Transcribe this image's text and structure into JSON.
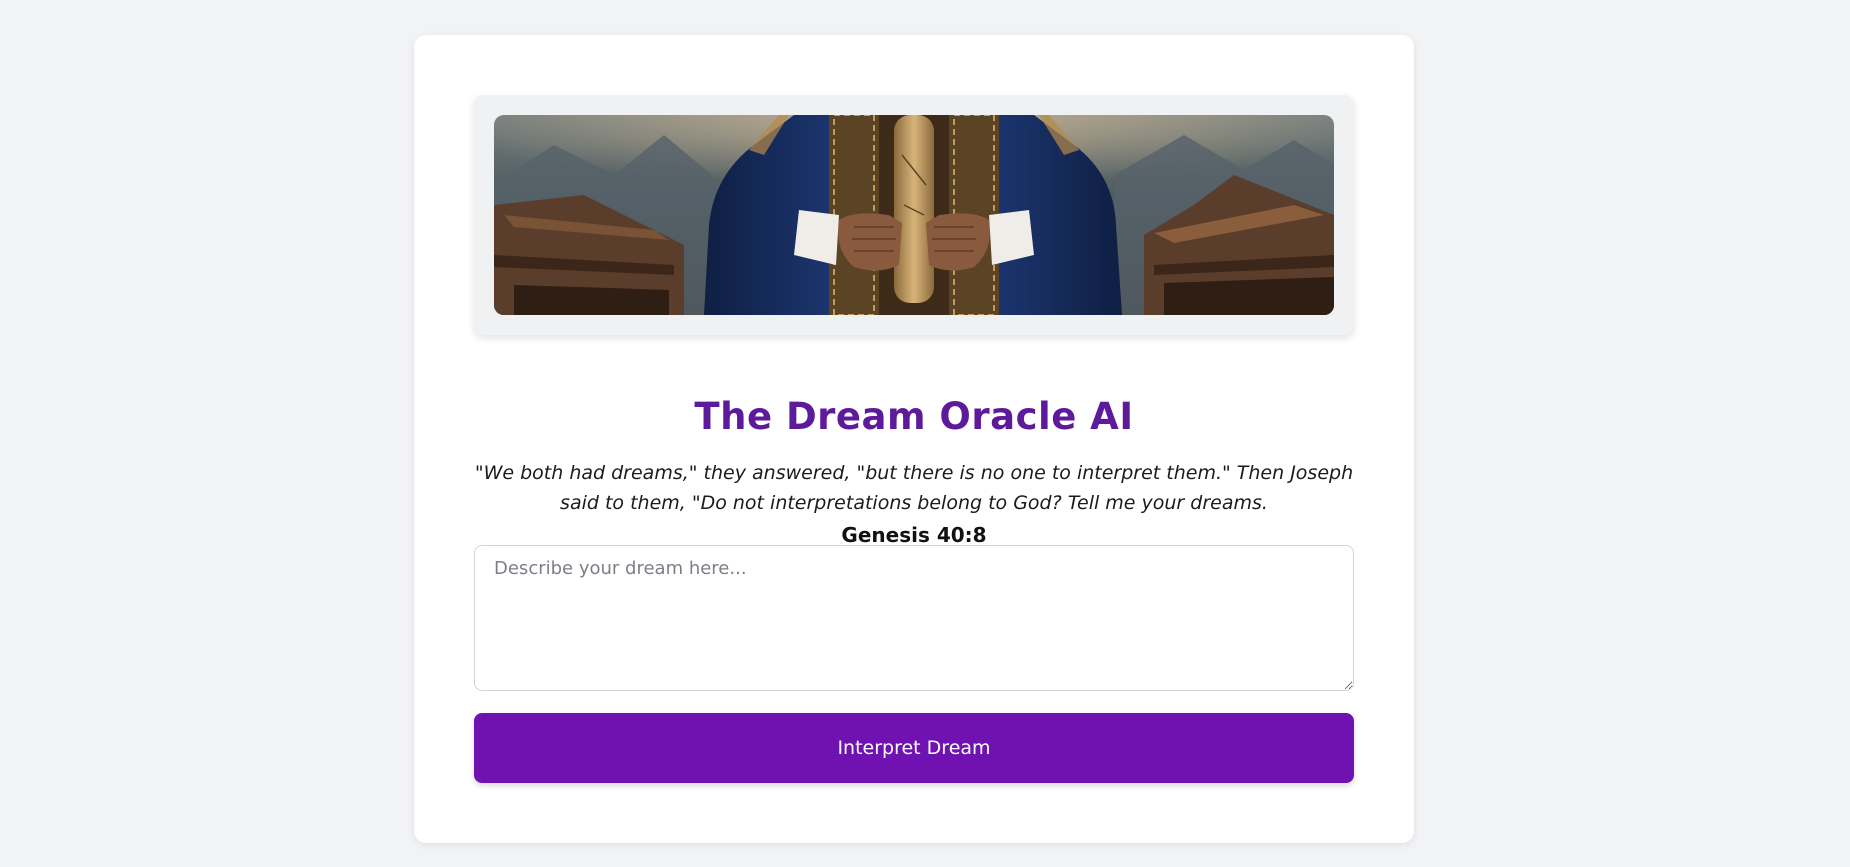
{
  "app": {
    "title": "The Dream Oracle AI"
  },
  "hero": {
    "image": "robed-figure-holding-scroll"
  },
  "quote": {
    "text": "\"We both had dreams,\" they answered, \"but there is no one to interpret them.\" Then Joseph said to them, \"Do not interpretations belong to God? Tell me your dreams.",
    "reference": "Genesis 40:8"
  },
  "form": {
    "dream_placeholder": "Describe your dream here...",
    "dream_value": "",
    "submit_label": "Interpret Dream"
  },
  "colors": {
    "accent": "#7011b2",
    "title": "#5d1a9a",
    "background": "#f2f3f5",
    "card": "#ffffff"
  }
}
